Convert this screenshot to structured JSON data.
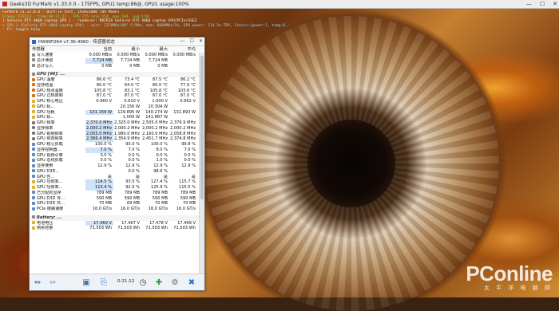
{
  "top_bar": {
    "title": "Geeks3D FurMark v1.33.0.0 - 175FPS, GPU1 temp:86@, GPU1 usage:100%",
    "minimize": "—",
    "maximize": "☐",
    "close": "✕"
  },
  "overlay": {
    "lines": [
      "FurMark v1.33.0.0 - Burn-in test, 1920x1080 (8X MSAA)",
      "Frames:228219 - time:00:21:21 - FPS:175 (min:154, max:184, avg:178)",
      "[ GeForce RTX 4060 Laptop GPU ] - renderer: NVIDIA GeForce RTX 4060 Laptop GPU/PCIe/SSE2",
      "> GPU 1 (GeForce RTX 4060 Laptop GPU) - core: 2370MHz/86° C/98%, mem: 8000MHz/5%, GPU power: 114.5% TDP, limits:[power:1, temp:0, volt:0, OV:0]",
      "- F1: toggle help"
    ]
  },
  "watermark": {
    "logo": "PConline",
    "sub": "太 平 洋 电 脑 网"
  },
  "hwinfo": {
    "title": "HWiNFO64 v7.36-4960 - 传感器状态",
    "columns": [
      "传感器",
      "当前",
      "最小",
      "最大",
      "平均"
    ],
    "rows": [
      {
        "type": "data",
        "icon": "ico",
        "name": "写入速度",
        "v": [
          "0.000 MB/s",
          "0.000 MB/s",
          "0.000 MB/s",
          "0.000 MB/s"
        ]
      },
      {
        "type": "data",
        "icon": "ico",
        "name": "总计读取",
        "v": [
          "7,724 MB",
          "7,724 MB",
          "7,724 MB",
          ""
        ],
        "hl": true
      },
      {
        "type": "data",
        "icon": "ico",
        "name": "总计写入",
        "v": [
          "0 MB",
          "0 MB",
          "0 MB",
          ""
        ]
      },
      {
        "type": "blank"
      },
      {
        "type": "sec",
        "name": "GPU [#0]: ...",
        "v": [
          "",
          "",
          "",
          ""
        ]
      },
      {
        "type": "data",
        "icon": "g",
        "name": "GPU 温度",
        "v": [
          "86.6 °C",
          "73.4 °C",
          "87.5 °C",
          "86.2 °C"
        ]
      },
      {
        "type": "data",
        "icon": "g",
        "name": "显存结温",
        "v": [
          "80.0 °C",
          "64.0 °C",
          "80.0 °C",
          "77.9 °C"
        ]
      },
      {
        "type": "data",
        "icon": "g",
        "name": "GPU 热点温度",
        "v": [
          "105.8 °C",
          "83.1 °C",
          "105.8 °C",
          "103.6 °C"
        ]
      },
      {
        "type": "data",
        "icon": "g",
        "name": "GPU 过热限制",
        "v": [
          "87.0 °C",
          "87.0 °C",
          "87.0 °C",
          "87.0 °C"
        ]
      },
      {
        "type": "data",
        "icon": "v",
        "name": "GPU 核心电压",
        "v": [
          "0.960 V",
          "0.910 V",
          "1.000 V",
          "0.962 V"
        ]
      },
      {
        "type": "data",
        "icon": "v",
        "name": "GPU 轨...",
        "v": [
          "",
          "20.156 W",
          "20.304 W",
          ""
        ]
      },
      {
        "type": "data",
        "icon": "v",
        "name": "GPU 功耗",
        "v": [
          "131.159 W",
          "129.895 W",
          "140.274 W",
          "132.893 W"
        ],
        "hl": true
      },
      {
        "type": "data",
        "icon": "v",
        "name": "GPU 轨...",
        "v": [
          "",
          "1.000 W",
          "141.887 W",
          ""
        ]
      },
      {
        "type": "data",
        "icon": "f",
        "name": "GPU 频率",
        "v": [
          "2,370.0 MHz",
          "2,325.0 MHz",
          "2,505.0 MHz",
          "2,376.9 MHz"
        ],
        "hl": true
      },
      {
        "type": "data",
        "icon": "f",
        "name": "显存频率",
        "v": [
          "2,000.2 MHz",
          "2,000.2 MHz",
          "2,000.2 MHz",
          "2,000.2 MHz"
        ],
        "hl": true
      },
      {
        "type": "data",
        "icon": "f",
        "name": "GPU 视频频率",
        "v": [
          "2,055.0 MHz",
          "1,980.0 MHz",
          "2,160.0 MHz",
          "2,058.8 MHz"
        ],
        "hl": true
      },
      {
        "type": "data",
        "icon": "f",
        "name": "GPU 有效频率",
        "v": [
          "2,366.4 MHz",
          "2,354.9 MHz",
          "2,451.7 MHz",
          "2,374.8 MHz"
        ],
        "hl": true
      },
      {
        "type": "data",
        "icon": "s",
        "name": "GPU 核心负载",
        "v": [
          "100.0 %",
          "93.0 %",
          "100.0 %",
          "99.8 %"
        ]
      },
      {
        "type": "data",
        "icon": "s",
        "name": "显存控制器...",
        "v": [
          "7.0 %",
          "7.0 %",
          "8.0 %",
          "7.0 %"
        ],
        "hl": true
      },
      {
        "type": "data",
        "icon": "s",
        "name": "GPU 视频引擎",
        "v": [
          "0.0 %",
          "0.0 %",
          "0.0 %",
          "0.0 %"
        ]
      },
      {
        "type": "data",
        "icon": "s",
        "name": "GPU 总线负载",
        "v": [
          "0.0 %",
          "0.0 %",
          "1.0 %",
          "0.0 %"
        ]
      },
      {
        "type": "data",
        "icon": "s",
        "name": "显存使用",
        "v": [
          "12.9 %",
          "12.9 %",
          "12.9 %",
          "12.9 %"
        ]
      },
      {
        "type": "data",
        "icon": "s",
        "name": "GPU D3D...",
        "v": [
          "",
          "0.0 %",
          "98.6 %",
          ""
        ]
      },
      {
        "type": "data",
        "icon": "s",
        "name": "GPU 性...",
        "v": [
          "是",
          "是",
          "是",
          "是"
        ]
      },
      {
        "type": "data",
        "icon": "v",
        "name": "GPU 功效率...",
        "v": [
          "114.5 %",
          "93.5 %",
          "127.4 %",
          "115.7 %"
        ],
        "hl": true
      },
      {
        "type": "data",
        "icon": "v",
        "name": "GPU 功效率...",
        "v": [
          "113.4 %",
          "92.0 %",
          "125.9 %",
          "115.5 %"
        ],
        "hl": true
      },
      {
        "type": "data",
        "icon": "s",
        "name": "已分配的显存",
        "v": [
          "789 MB",
          "789 MB",
          "789 MB",
          "789 MB"
        ]
      },
      {
        "type": "data",
        "icon": "s",
        "name": "GPU D3D 专...",
        "v": [
          "590 MB",
          "590 MB",
          "590 MB",
          "590 MB"
        ]
      },
      {
        "type": "data",
        "icon": "s",
        "name": "GPU D3D 共...",
        "v": [
          "70 MB",
          "69 MB",
          "70 MB",
          "70 MB"
        ]
      },
      {
        "type": "data",
        "icon": "s",
        "name": "PCIe 链路速度",
        "v": [
          "16.0 GT/s",
          "16.0 GT/s",
          "16.0 GT/s",
          "16.0 GT/s"
        ]
      },
      {
        "type": "blank"
      },
      {
        "type": "sec",
        "name": "Battery: ...",
        "v": [
          "",
          "",
          "",
          ""
        ]
      },
      {
        "type": "data",
        "icon": "v",
        "name": "电池电压",
        "v": [
          "17.460 V",
          "17.467 V",
          "17.478 V",
          "17.469 V"
        ],
        "hl": true
      },
      {
        "type": "data",
        "icon": "v",
        "name": "剩余容量",
        "v": [
          "71.503 Wh",
          "71.503 Wh",
          "71.503 Wh",
          "71.503 Wh"
        ]
      }
    ],
    "toolbar": {
      "time": "0:21:12"
    }
  }
}
